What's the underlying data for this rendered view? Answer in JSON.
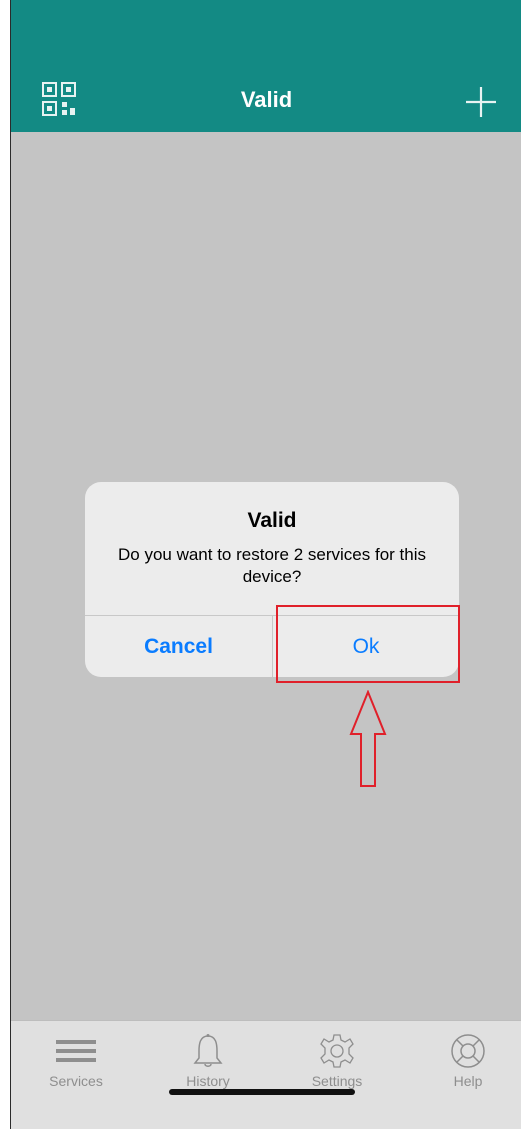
{
  "navbar": {
    "title": "Valid",
    "left_icon": "qr-code-icon",
    "right_icon": "plus-icon"
  },
  "alert": {
    "title": "Valid",
    "message": "Do you want to restore 2 services for this device?",
    "cancel_label": "Cancel",
    "ok_label": "Ok"
  },
  "tabbar": {
    "items": [
      {
        "label": "Services",
        "icon": "list-icon"
      },
      {
        "label": "History",
        "icon": "bell-icon"
      },
      {
        "label": "Settings",
        "icon": "gear-icon"
      },
      {
        "label": "Help",
        "icon": "lifebuoy-icon"
      }
    ]
  },
  "colors": {
    "header": "#138a84",
    "background": "#c4c4c4",
    "alert_button": "#0a7cff",
    "annotation": "#e0202a"
  }
}
